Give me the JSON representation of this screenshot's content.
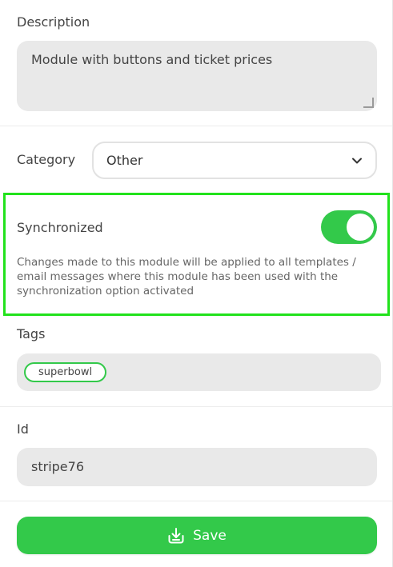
{
  "description": {
    "label": "Description",
    "value": "Module with buttons and ticket prices"
  },
  "category": {
    "label": "Category",
    "selected": "Other"
  },
  "synchronized": {
    "label": "Synchronized",
    "enabled": true,
    "help_text": "Changes made to this module will be applied to all templates / email messages where this module has been used with the synchronization option activated",
    "highlight_color": "#22e21c"
  },
  "tags": {
    "label": "Tags",
    "items": [
      "superbowl"
    ]
  },
  "id": {
    "label": "Id",
    "value": "stripe76"
  },
  "save": {
    "label": "Save",
    "icon": "download-icon"
  },
  "colors": {
    "accent": "#33c94a",
    "field_bg": "#e9e9e9"
  }
}
